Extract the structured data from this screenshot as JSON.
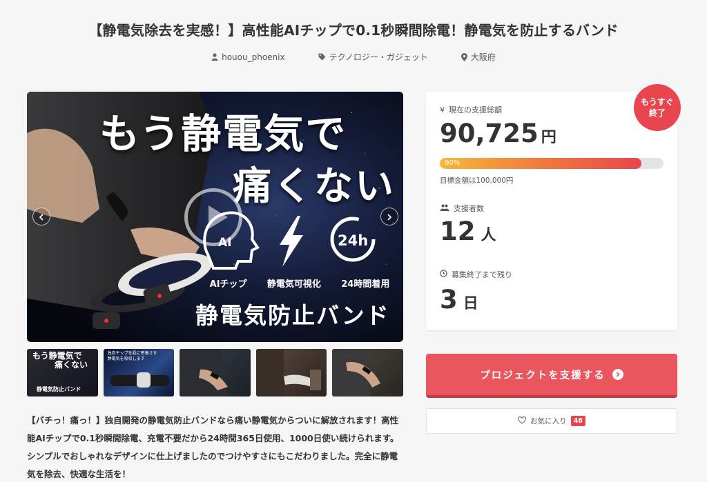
{
  "project": {
    "title": "【静電気除去を実感！】高性能AIチップで0.1秒瞬間除電！静電気を防止するバンド",
    "author": "houou_phoenix",
    "category": "テクノロジー・ガジェット",
    "location": "大阪府"
  },
  "gallery": {
    "hero_line1": "もう静電気で",
    "hero_line2": "痛くない",
    "features": [
      "AIチップ",
      "静電気可視化",
      "24時間着用"
    ],
    "feature_icon_labels": [
      "AI",
      "24h"
    ],
    "product_name": "静電気防止バンド",
    "thumbnails": [
      {
        "line1": "もう静電気で",
        "line2": "痛くない",
        "bottom": "静電気防止バンド"
      },
      {
        "line1": "独自チップを肌に密着させ",
        "line2": "静電気を吸収します"
      },
      {},
      {},
      {}
    ]
  },
  "description": "【バチっ！痛っ！】独自開発の静電気防止バンドなら痛い静電気からついに解放されます！高性能AIチップで0.1秒瞬間除電、充電不要だから24時間365日使用、1000日使い続けられます。シンプルでおしゃれなデザインに仕上げましたのでつけやすさにもこだわりました。完全に静電気を除去、快適な生活を！",
  "stats": {
    "badge": "もうすぐ\n終了",
    "total_label": "現在の支援総額",
    "total_amount": "90,725",
    "currency_unit": "円",
    "progress_percent": 90,
    "progress_label": "90%",
    "goal_text": "目標金額は100,000円",
    "supporters_label": "支援者数",
    "supporters_count": "12",
    "supporters_unit": "人",
    "remaining_label": "募集終了まで残り",
    "remaining_days": "3",
    "remaining_unit": "日"
  },
  "actions": {
    "support_label": "プロジェクトを支援する",
    "favorite_label": "お気に入り",
    "favorite_count": "48"
  },
  "colors": {
    "accent": "#e9454e",
    "button": "#e9565e",
    "progress_start": "#f6b73b"
  }
}
